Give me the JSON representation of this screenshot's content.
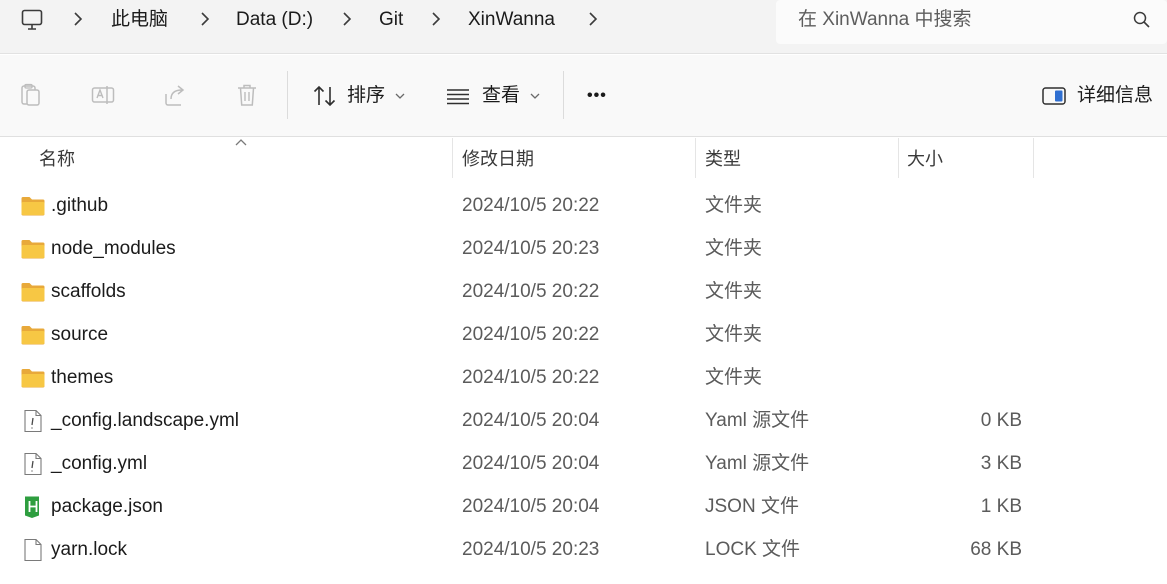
{
  "breadcrumb": {
    "root_icon": "computer-monitor-icon",
    "items": [
      "此电脑",
      "Data (D:)",
      "Git",
      "XinWanna"
    ]
  },
  "search": {
    "placeholder": "在 XinWanna 中搜索"
  },
  "toolbar": {
    "sort_label": "排序",
    "view_label": "查看",
    "more_label": "•••",
    "details_label": "详细信息"
  },
  "columns": {
    "name": "名称",
    "date": "修改日期",
    "type": "类型",
    "size": "大小"
  },
  "files": [
    {
      "name": ".github",
      "date": "2024/10/5 20:22",
      "type": "文件夹",
      "size": "",
      "icon": "folder"
    },
    {
      "name": "node_modules",
      "date": "2024/10/5 20:23",
      "type": "文件夹",
      "size": "",
      "icon": "folder"
    },
    {
      "name": "scaffolds",
      "date": "2024/10/5 20:22",
      "type": "文件夹",
      "size": "",
      "icon": "folder"
    },
    {
      "name": "source",
      "date": "2024/10/5 20:22",
      "type": "文件夹",
      "size": "",
      "icon": "folder"
    },
    {
      "name": "themes",
      "date": "2024/10/5 20:22",
      "type": "文件夹",
      "size": "",
      "icon": "folder"
    },
    {
      "name": "_config.landscape.yml",
      "date": "2024/10/5 20:04",
      "type": "Yaml 源文件",
      "size": "0 KB",
      "icon": "yaml"
    },
    {
      "name": "_config.yml",
      "date": "2024/10/5 20:04",
      "type": "Yaml 源文件",
      "size": "3 KB",
      "icon": "yaml"
    },
    {
      "name": "package.json",
      "date": "2024/10/5 20:04",
      "type": "JSON 文件",
      "size": "1 KB",
      "icon": "json"
    },
    {
      "name": "yarn.lock",
      "date": "2024/10/5 20:23",
      "type": "LOCK 文件",
      "size": "68 KB",
      "icon": "file"
    }
  ],
  "colors": {
    "folder": "#f7c744",
    "folder_back": "#e8a93a",
    "json_green": "#2e9e3f",
    "accent": "#2f6fd1"
  }
}
